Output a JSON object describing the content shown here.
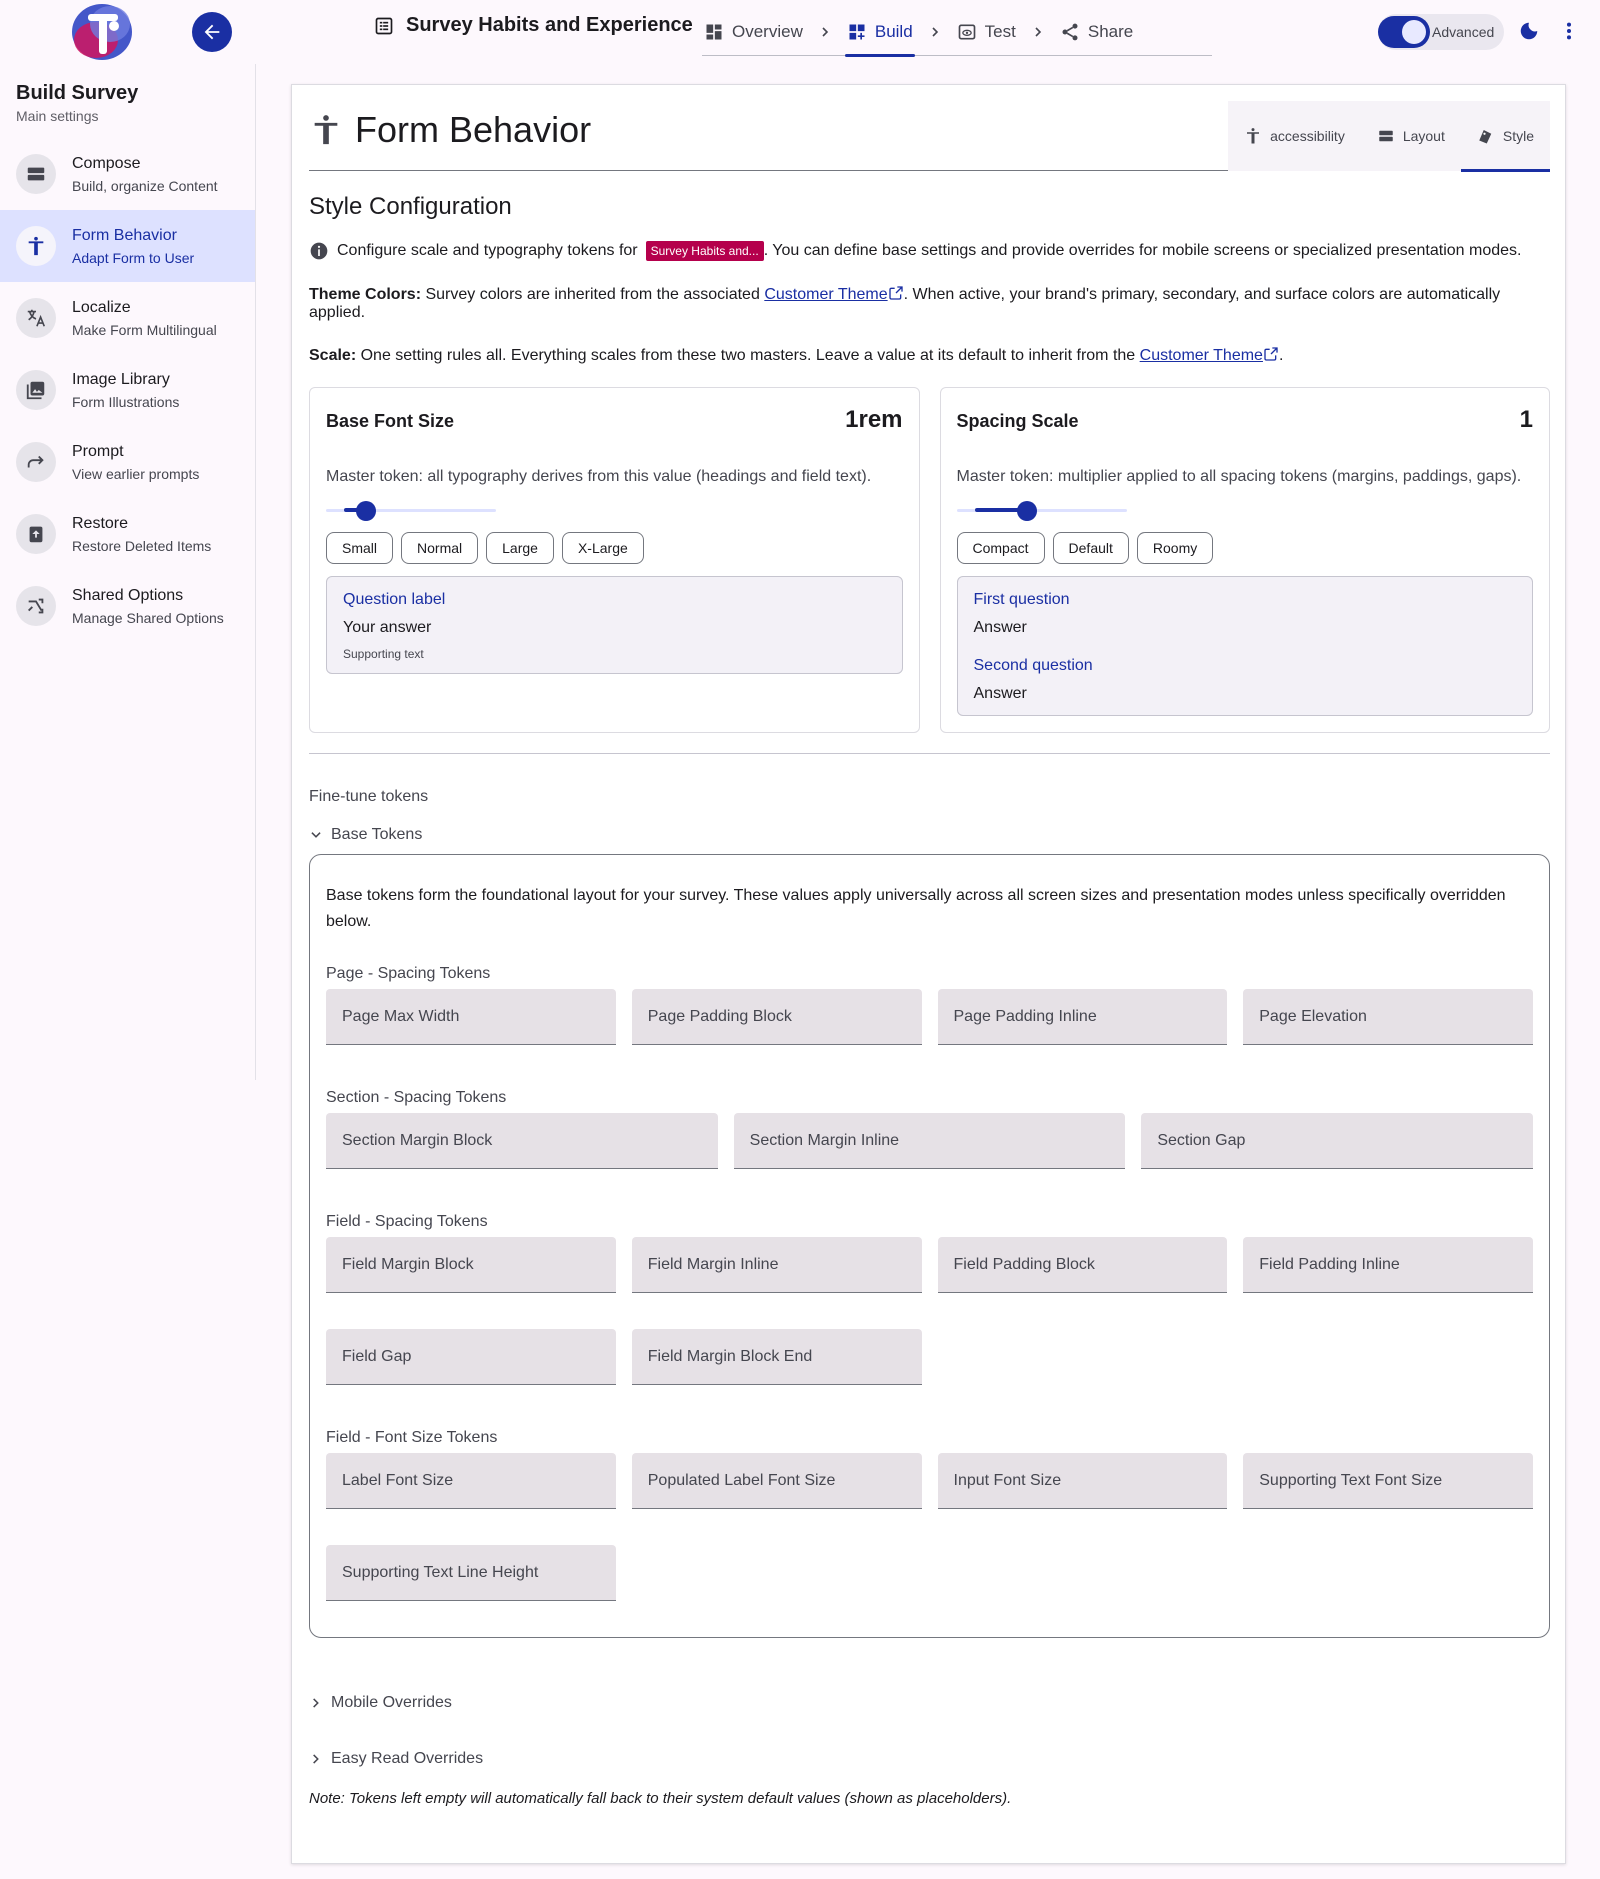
{
  "header": {
    "survey_title": "Survey Habits and Experience",
    "steps": [
      {
        "label": "Overview",
        "icon": "dashboard-icon"
      },
      {
        "label": "Build",
        "icon": "build-grid-icon"
      },
      {
        "label": "Test",
        "icon": "preview-icon"
      },
      {
        "label": "Share",
        "icon": "share-icon"
      }
    ],
    "advanced_label": "Advanced",
    "advanced_on": true,
    "accent": "#1a2fa3"
  },
  "sidebar": {
    "title": "Build Survey",
    "subtitle": "Main settings",
    "items": [
      {
        "label": "Compose",
        "sub": "Build, organize Content",
        "icon": "compose-icon"
      },
      {
        "label": "Form Behavior",
        "sub": "Adapt Form to User",
        "icon": "accessibility-icon"
      },
      {
        "label": "Localize",
        "sub": "Make Form Multilingual",
        "icon": "translate-icon"
      },
      {
        "label": "Image Library",
        "sub": "Form Illustrations",
        "icon": "image-icon"
      },
      {
        "label": "Prompt",
        "sub": "View earlier prompts",
        "icon": "redo-icon"
      },
      {
        "label": "Restore",
        "sub": "Restore Deleted Items",
        "icon": "restore-icon"
      },
      {
        "label": "Shared Options",
        "sub": "Manage Shared Options",
        "icon": "shuffle-icon"
      }
    ]
  },
  "main": {
    "title": "Form Behavior",
    "tabs": [
      {
        "label": "accessibility",
        "icon": "accessibility-icon"
      },
      {
        "label": "Layout",
        "icon": "layout-icon"
      },
      {
        "label": "Style",
        "icon": "style-icon"
      }
    ],
    "section_title": "Style Configuration",
    "info_prefix": "Configure scale and typography tokens for",
    "survey_chip": "Survey Habits and...",
    "info_suffix": ". You can define base settings and provide overrides for mobile screens or specialized presentation modes.",
    "theme_label": "Theme Colors:",
    "theme_text_a": "Survey colors are inherited from the associated",
    "theme_link": "Customer Theme",
    "theme_text_b": ". When active, your brand's primary, secondary, and surface colors are automatically applied.",
    "scale_label": "Scale:",
    "scale_text": "One setting rules all. Everything scales from these two masters. Leave a value at its default to inherit from the",
    "scale_link": "Customer Theme",
    "scale_end": ".",
    "font_box": {
      "title": "Base Font Size",
      "value": "1rem",
      "desc": "Master token: all typography derives from this value (headings and field text).",
      "slider_fraction": 0.2,
      "presets": [
        "Small",
        "Normal",
        "Large",
        "X-Large"
      ],
      "preview": {
        "question": "Question label",
        "answer": "Your answer",
        "support": "Supporting text"
      }
    },
    "spacing_box": {
      "title": "Spacing Scale",
      "value": "1",
      "desc": "Master token: multiplier applied to all spacing tokens (margins, paddings, gaps).",
      "slider_fraction": 0.4,
      "presets": [
        "Compact",
        "Default",
        "Roomy"
      ],
      "preview": {
        "q1": "First question",
        "a1": "Answer",
        "q2": "Second question",
        "a2": "Answer"
      }
    },
    "finetune_label": "Fine-tune tokens",
    "base_tokens_label": "Base Tokens",
    "base_tokens_desc": "Base tokens form the foundational layout for your survey. These values apply universally across all screen sizes and presentation modes unless specifically overridden below.",
    "groups": {
      "page": {
        "title": "Page - Spacing Tokens",
        "fields": [
          "Page Max Width",
          "Page Padding Block",
          "Page Padding Inline",
          "Page Elevation"
        ]
      },
      "section": {
        "title": "Section - Spacing Tokens",
        "fields": [
          "Section Margin Block",
          "Section Margin Inline",
          "Section Gap"
        ]
      },
      "field_spacing": {
        "title": "Field - Spacing Tokens",
        "fields": [
          "Field Margin Block",
          "Field Margin Inline",
          "Field Padding Block",
          "Field Padding Inline",
          "Field Gap",
          "Field Margin Block End"
        ]
      },
      "field_font": {
        "title": "Field - Font Size Tokens",
        "fields": [
          "Label Font Size",
          "Populated Label Font Size",
          "Input Font Size",
          "Supporting Text Font Size",
          "Supporting Text Line Height"
        ]
      }
    },
    "mobile_overrides_label": "Mobile Overrides",
    "easy_read_label": "Easy Read Overrides",
    "note": "Note: Tokens left empty will automatically fall back to their system default values (shown as placeholders)."
  }
}
